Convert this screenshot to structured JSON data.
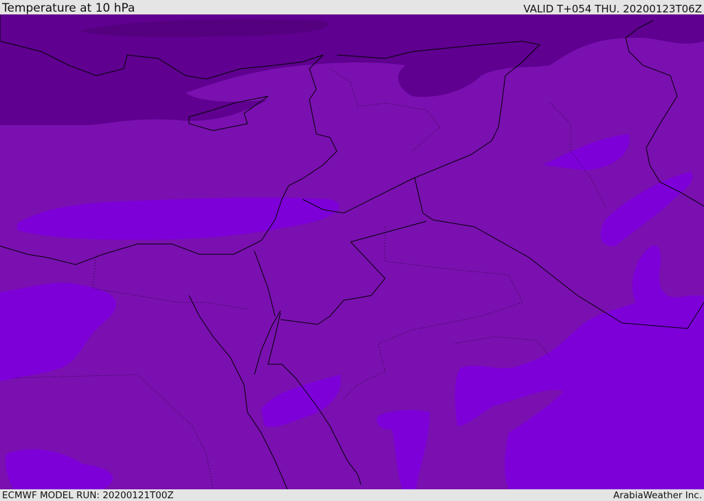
{
  "header": {
    "title": "Temperature at 10 hPa",
    "valid": "VALID T+054 THU. 20200123T06Z"
  },
  "footer": {
    "model_run": "ECMWF MODEL RUN: 20200121T00Z",
    "brand": "ArabiaWeather Inc."
  },
  "colors": {
    "cold": "#5f0090",
    "mid": "#7a10b0",
    "warm": "#7d00d9",
    "coast": "#000000"
  }
}
